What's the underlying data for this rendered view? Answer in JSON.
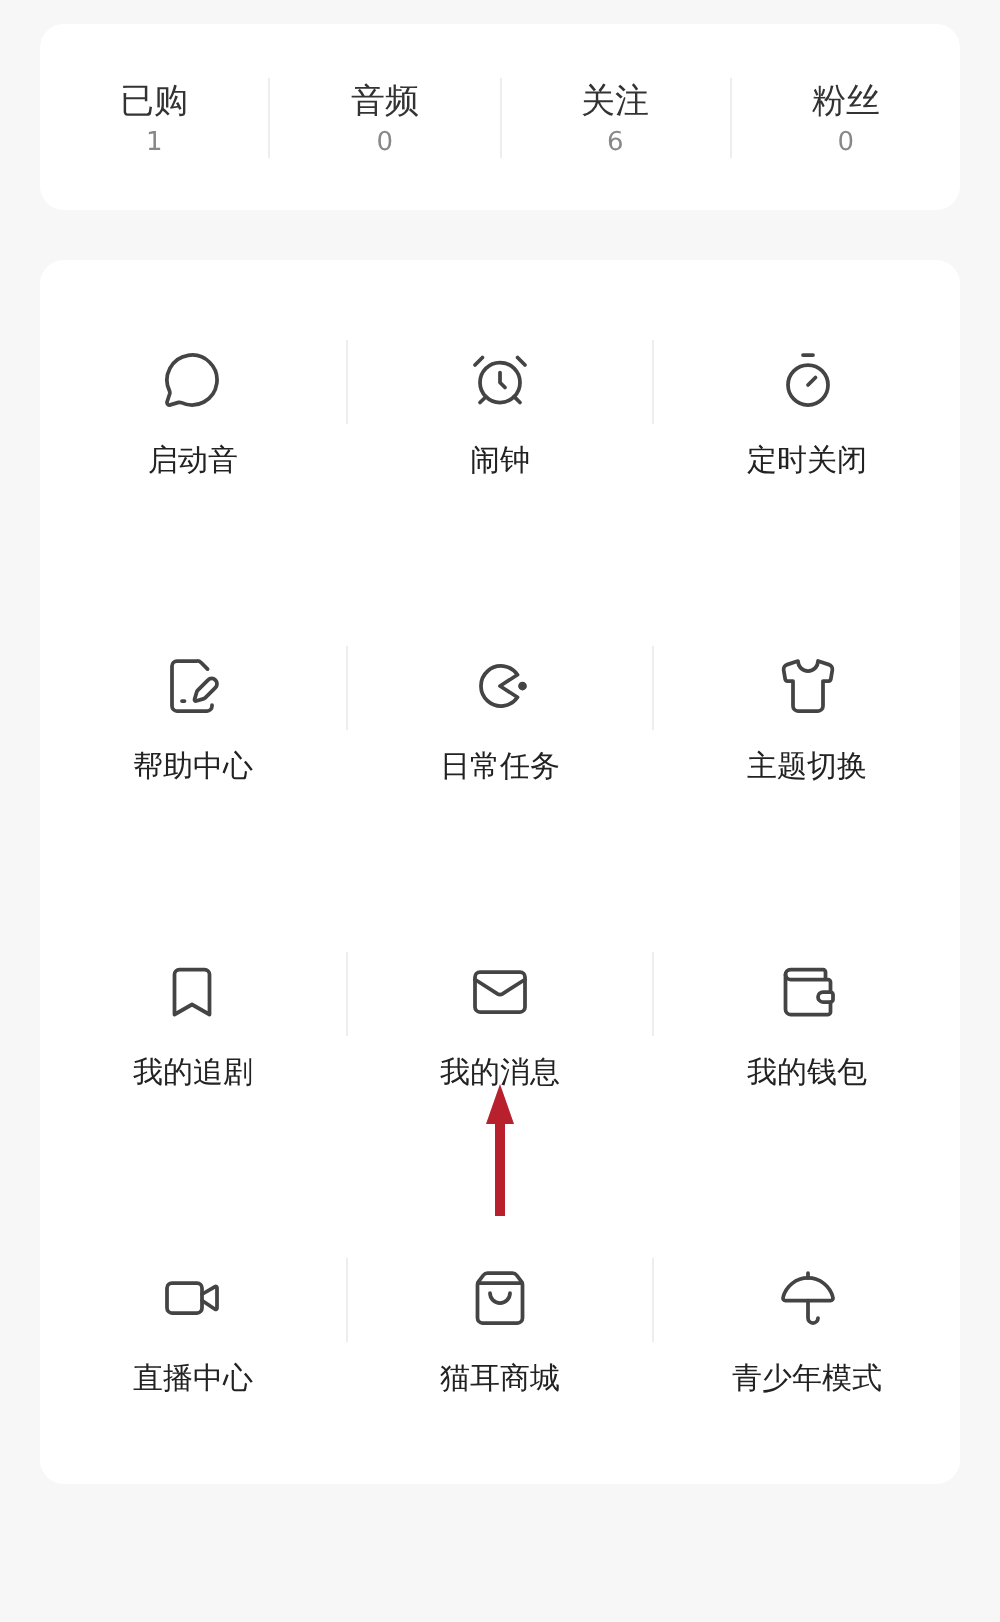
{
  "stats": [
    {
      "label": "已购",
      "value": "1"
    },
    {
      "label": "音频",
      "value": "0"
    },
    {
      "label": "关注",
      "value": "6"
    },
    {
      "label": "粉丝",
      "value": "0"
    }
  ],
  "menu": {
    "rows": [
      [
        {
          "label": "启动音"
        },
        {
          "label": "闹钟"
        },
        {
          "label": "定时关闭"
        }
      ],
      [
        {
          "label": "帮助中心"
        },
        {
          "label": "日常任务"
        },
        {
          "label": "主题切换"
        }
      ],
      [
        {
          "label": "我的追剧"
        },
        {
          "label": "我的消息"
        },
        {
          "label": "我的钱包"
        }
      ],
      [
        {
          "label": "直播中心"
        },
        {
          "label": "猫耳商城"
        },
        {
          "label": "青少年模式"
        }
      ]
    ]
  }
}
